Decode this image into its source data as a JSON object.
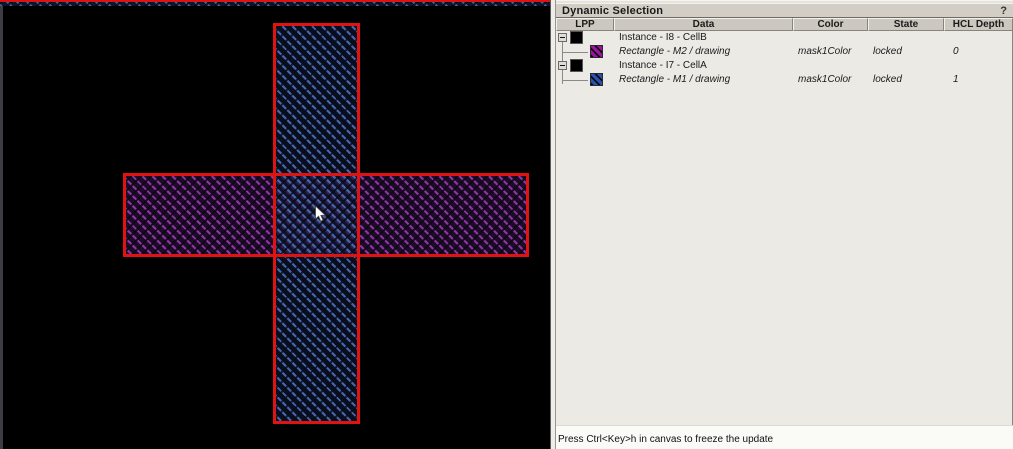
{
  "panel": {
    "title": "Dynamic Selection",
    "help_label": "?",
    "columns": [
      "LPP",
      "Data",
      "Color",
      "State",
      "HCL Depth"
    ],
    "rows": [
      {
        "data": "Instance - I8 - CellB",
        "color": "",
        "state": "",
        "depth": ""
      },
      {
        "data": "Rectangle - M2 / drawing",
        "color": "mask1Color",
        "state": "locked",
        "depth": "0"
      },
      {
        "data": "Instance - I7 - CellA",
        "color": "",
        "state": "",
        "depth": ""
      },
      {
        "data": "Rectangle - M1 / drawing",
        "color": "mask1Color",
        "state": "locked",
        "depth": "1"
      }
    ],
    "status": "Press Ctrl<Key>h in canvas to freeze the update"
  },
  "canvas": {
    "shape_outline_color": "#e01212",
    "m1_layer": {
      "name": "M1 / drawing",
      "stripe": "#4666ac",
      "background": "#0c1426"
    },
    "m2_layer": {
      "name": "M2 / drawing",
      "stripe": "#8c34a0",
      "background": "#170b21"
    },
    "swatch_colors": {
      "m1": "#2a52b0",
      "m2": "#9c14a2",
      "instance": "#000000"
    }
  }
}
